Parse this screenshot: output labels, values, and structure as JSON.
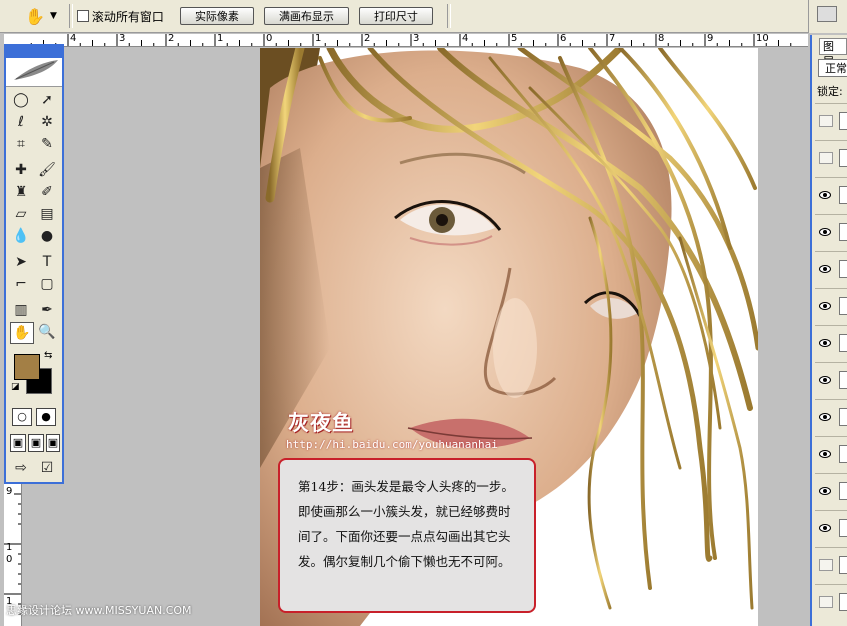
{
  "options_bar": {
    "hand_tool_icon": "hand-icon",
    "scroll_all_windows_label": "滚动所有窗口",
    "scroll_all_windows_checked": false,
    "actual_pixels_label": "实际像素",
    "fit_screen_label": "满画布显示",
    "print_size_label": "打印尺寸"
  },
  "rulers": {
    "horizontal_ticks": [
      "4",
      "3",
      "2",
      "1",
      "0",
      "1",
      "2",
      "3",
      "4",
      "5",
      "6",
      "7",
      "8",
      "9",
      "10"
    ],
    "vertical_ticks": [
      "9",
      "1",
      "0",
      "1"
    ]
  },
  "layers_panel": {
    "tab_label": "图层",
    "blend_mode": "正常",
    "lock_label": "锁定:",
    "rows": [
      {
        "visible": false
      },
      {
        "visible": false
      },
      {
        "visible": true
      },
      {
        "visible": true
      },
      {
        "visible": true
      },
      {
        "visible": true
      },
      {
        "visible": true
      },
      {
        "visible": true
      },
      {
        "visible": true
      },
      {
        "visible": true
      },
      {
        "visible": true
      },
      {
        "visible": true
      },
      {
        "visible": false
      },
      {
        "visible": false
      }
    ]
  },
  "toolbox": {
    "foreground_color": "#a37f45",
    "background_color": "#000000"
  },
  "overlay": {
    "brand": "灰夜鱼",
    "url": "http://hi.baidu.com/youhuananhai",
    "tutorial_text": "第14步：画头发是最令人头疼的一步。即使画那么一小簇头发，就已经够费时间了。下面你还要一点点勾画出其它头发。偶尔复制几个偷下懒也无不可阿。",
    "watermark": "思缘设计论坛 www.MISSYUAN.COM"
  },
  "colors": {
    "accent_border": "#c8202a",
    "panel_border": "#3c6fd8"
  }
}
